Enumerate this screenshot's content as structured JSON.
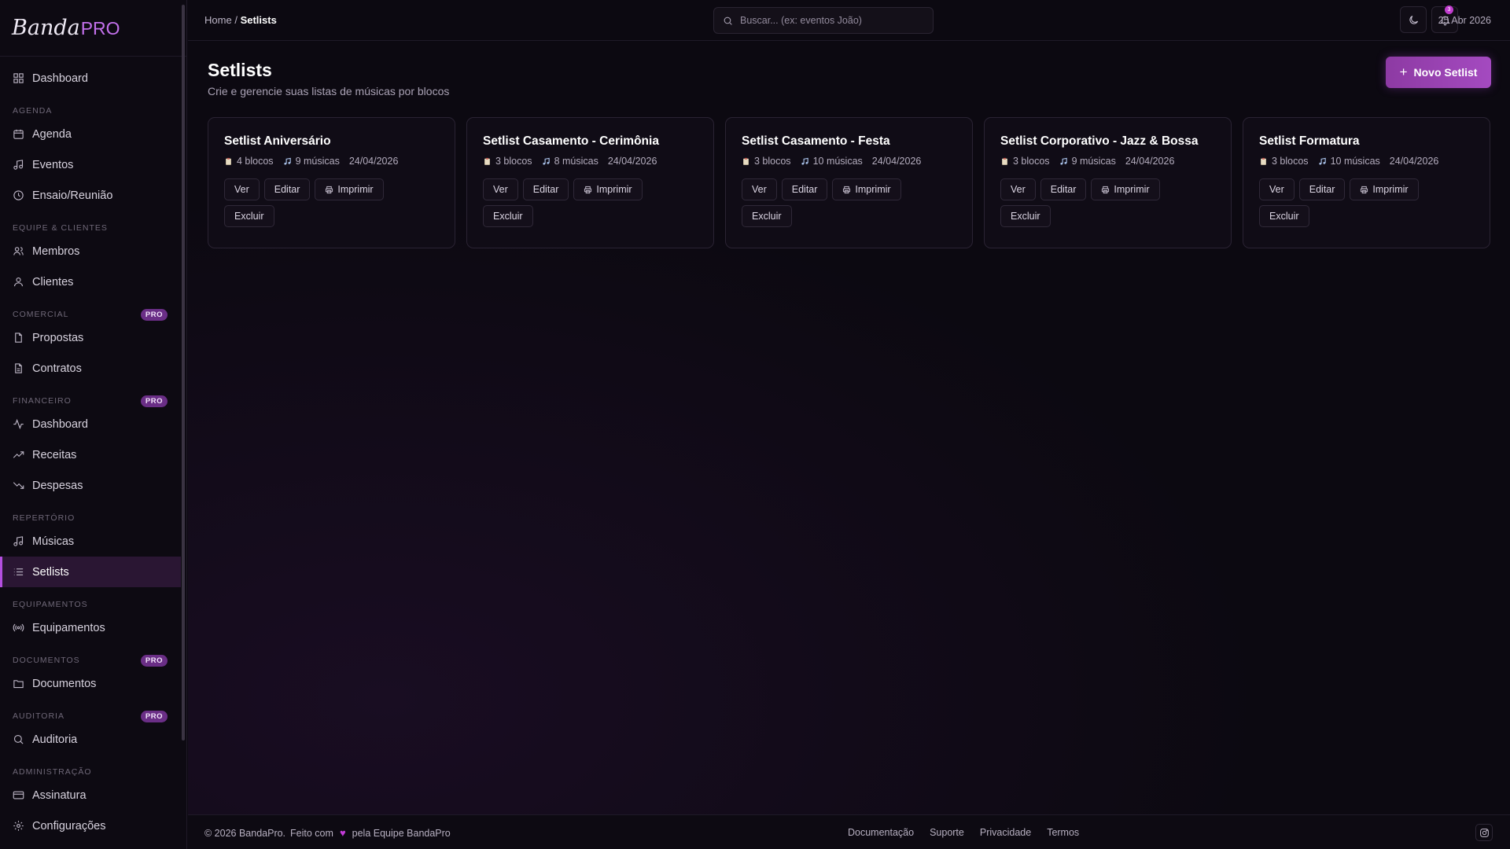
{
  "app": {
    "logo_script": "Banda",
    "logo_pro": "PRO"
  },
  "sidebar": {
    "groups": [
      {
        "label": "",
        "pro": "",
        "items": [
          {
            "label": "Dashboard",
            "icon": "grid-icon"
          }
        ]
      },
      {
        "label": "AGENDA",
        "pro": "",
        "items": [
          {
            "label": "Agenda",
            "icon": "calendar-icon"
          },
          {
            "label": "Eventos",
            "icon": "music-note-icon"
          },
          {
            "label": "Ensaio/Reunião",
            "icon": "clock-icon"
          }
        ]
      },
      {
        "label": "EQUIPE & CLIENTES",
        "pro": "",
        "items": [
          {
            "label": "Membros",
            "icon": "users-icon"
          },
          {
            "label": "Clientes",
            "icon": "user-icon"
          }
        ]
      },
      {
        "label": "COMERCIAL",
        "pro": "PRO",
        "items": [
          {
            "label": "Propostas",
            "icon": "file-icon"
          },
          {
            "label": "Contratos",
            "icon": "file-text-icon"
          }
        ]
      },
      {
        "label": "FINANCEIRO",
        "pro": "PRO",
        "items": [
          {
            "label": "Dashboard",
            "icon": "activity-icon"
          },
          {
            "label": "Receitas",
            "icon": "trending-up-icon"
          },
          {
            "label": "Despesas",
            "icon": "trending-down-icon"
          }
        ]
      },
      {
        "label": "REPERTÓRIO",
        "pro": "",
        "items": [
          {
            "label": "Músicas",
            "icon": "music-note-icon"
          },
          {
            "label": "Setlists",
            "icon": "list-icon",
            "active": true
          }
        ]
      },
      {
        "label": "EQUIPAMENTOS",
        "pro": "",
        "items": [
          {
            "label": "Equipamentos",
            "icon": "radio-icon"
          }
        ]
      },
      {
        "label": "DOCUMENTOS",
        "pro": "PRO",
        "items": [
          {
            "label": "Documentos",
            "icon": "folder-icon"
          }
        ]
      },
      {
        "label": "AUDITORIA",
        "pro": "PRO",
        "items": [
          {
            "label": "Auditoria",
            "icon": "search-icon"
          }
        ]
      },
      {
        "label": "ADMINISTRAÇÃO",
        "pro": "",
        "items": [
          {
            "label": "Assinatura",
            "icon": "credit-card-icon"
          },
          {
            "label": "Configurações",
            "icon": "gear-icon"
          }
        ]
      }
    ]
  },
  "header": {
    "breadcrumb_home": "Home",
    "breadcrumb_sep": "/",
    "breadcrumb_current": "Setlists",
    "search_placeholder": "Buscar... (ex: eventos João)",
    "notification_count": "3",
    "date": "25 Abr 2026"
  },
  "page": {
    "title": "Setlists",
    "subtitle": "Crie e gerencie suas listas de músicas por blocos",
    "new_button": "Novo Setlist",
    "new_button_plus": "+"
  },
  "setlists": [
    {
      "title": "Setlist Aniversário",
      "blocks": "4 blocos",
      "songs": "9 músicas",
      "date": "24/04/2026"
    },
    {
      "title": "Setlist Casamento - Cerimônia",
      "blocks": "3 blocos",
      "songs": "8 músicas",
      "date": "24/04/2026"
    },
    {
      "title": "Setlist Casamento - Festa",
      "blocks": "3 blocos",
      "songs": "10 músicas",
      "date": "24/04/2026"
    },
    {
      "title": "Setlist Corporativo - Jazz & Bossa",
      "blocks": "3 blocos",
      "songs": "9 músicas",
      "date": "24/04/2026"
    },
    {
      "title": "Setlist Formatura",
      "blocks": "3 blocos",
      "songs": "10 músicas",
      "date": "24/04/2026"
    }
  ],
  "card_actions": {
    "view": "Ver",
    "edit": "Editar",
    "print": "Imprimir",
    "delete": "Excluir"
  },
  "footer": {
    "copyright": "© 2026 BandaPro.",
    "made_with": "Feito com",
    "by_team": "pela Equipe BandaPro",
    "links": [
      "Documentação",
      "Suporte",
      "Privacidade",
      "Termos"
    ]
  },
  "colors": {
    "accent": "#a44ac0",
    "background": "#0c0911",
    "pro_badge": "#6a2e86"
  }
}
